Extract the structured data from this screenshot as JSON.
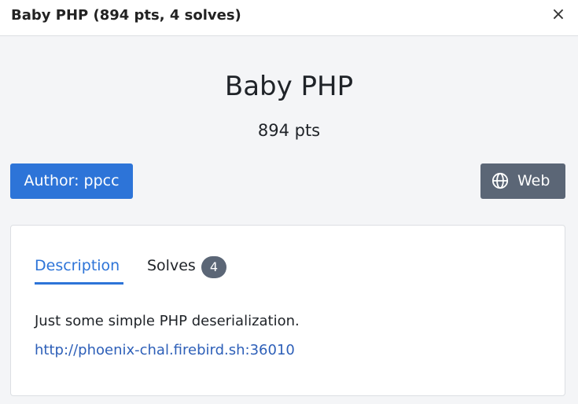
{
  "header": {
    "title": "Baby PHP (894 pts, 4 solves)",
    "close_glyph": "×"
  },
  "challenge": {
    "name": "Baby PHP",
    "points": "894 pts",
    "author_label": "Author: ppcc",
    "category": "Web",
    "category_icon": "globe-icon"
  },
  "tabs": {
    "description_label": "Description",
    "solves_label": "Solves",
    "solves_count": "4",
    "active": "Description"
  },
  "description": {
    "text": "Just some simple PHP deserialization.",
    "link": "http://phoenix-chal.firebird.sh:36010"
  },
  "colors": {
    "accent": "#2d74d8",
    "badge_gray": "#5b6676",
    "background": "#f4f5f7"
  }
}
